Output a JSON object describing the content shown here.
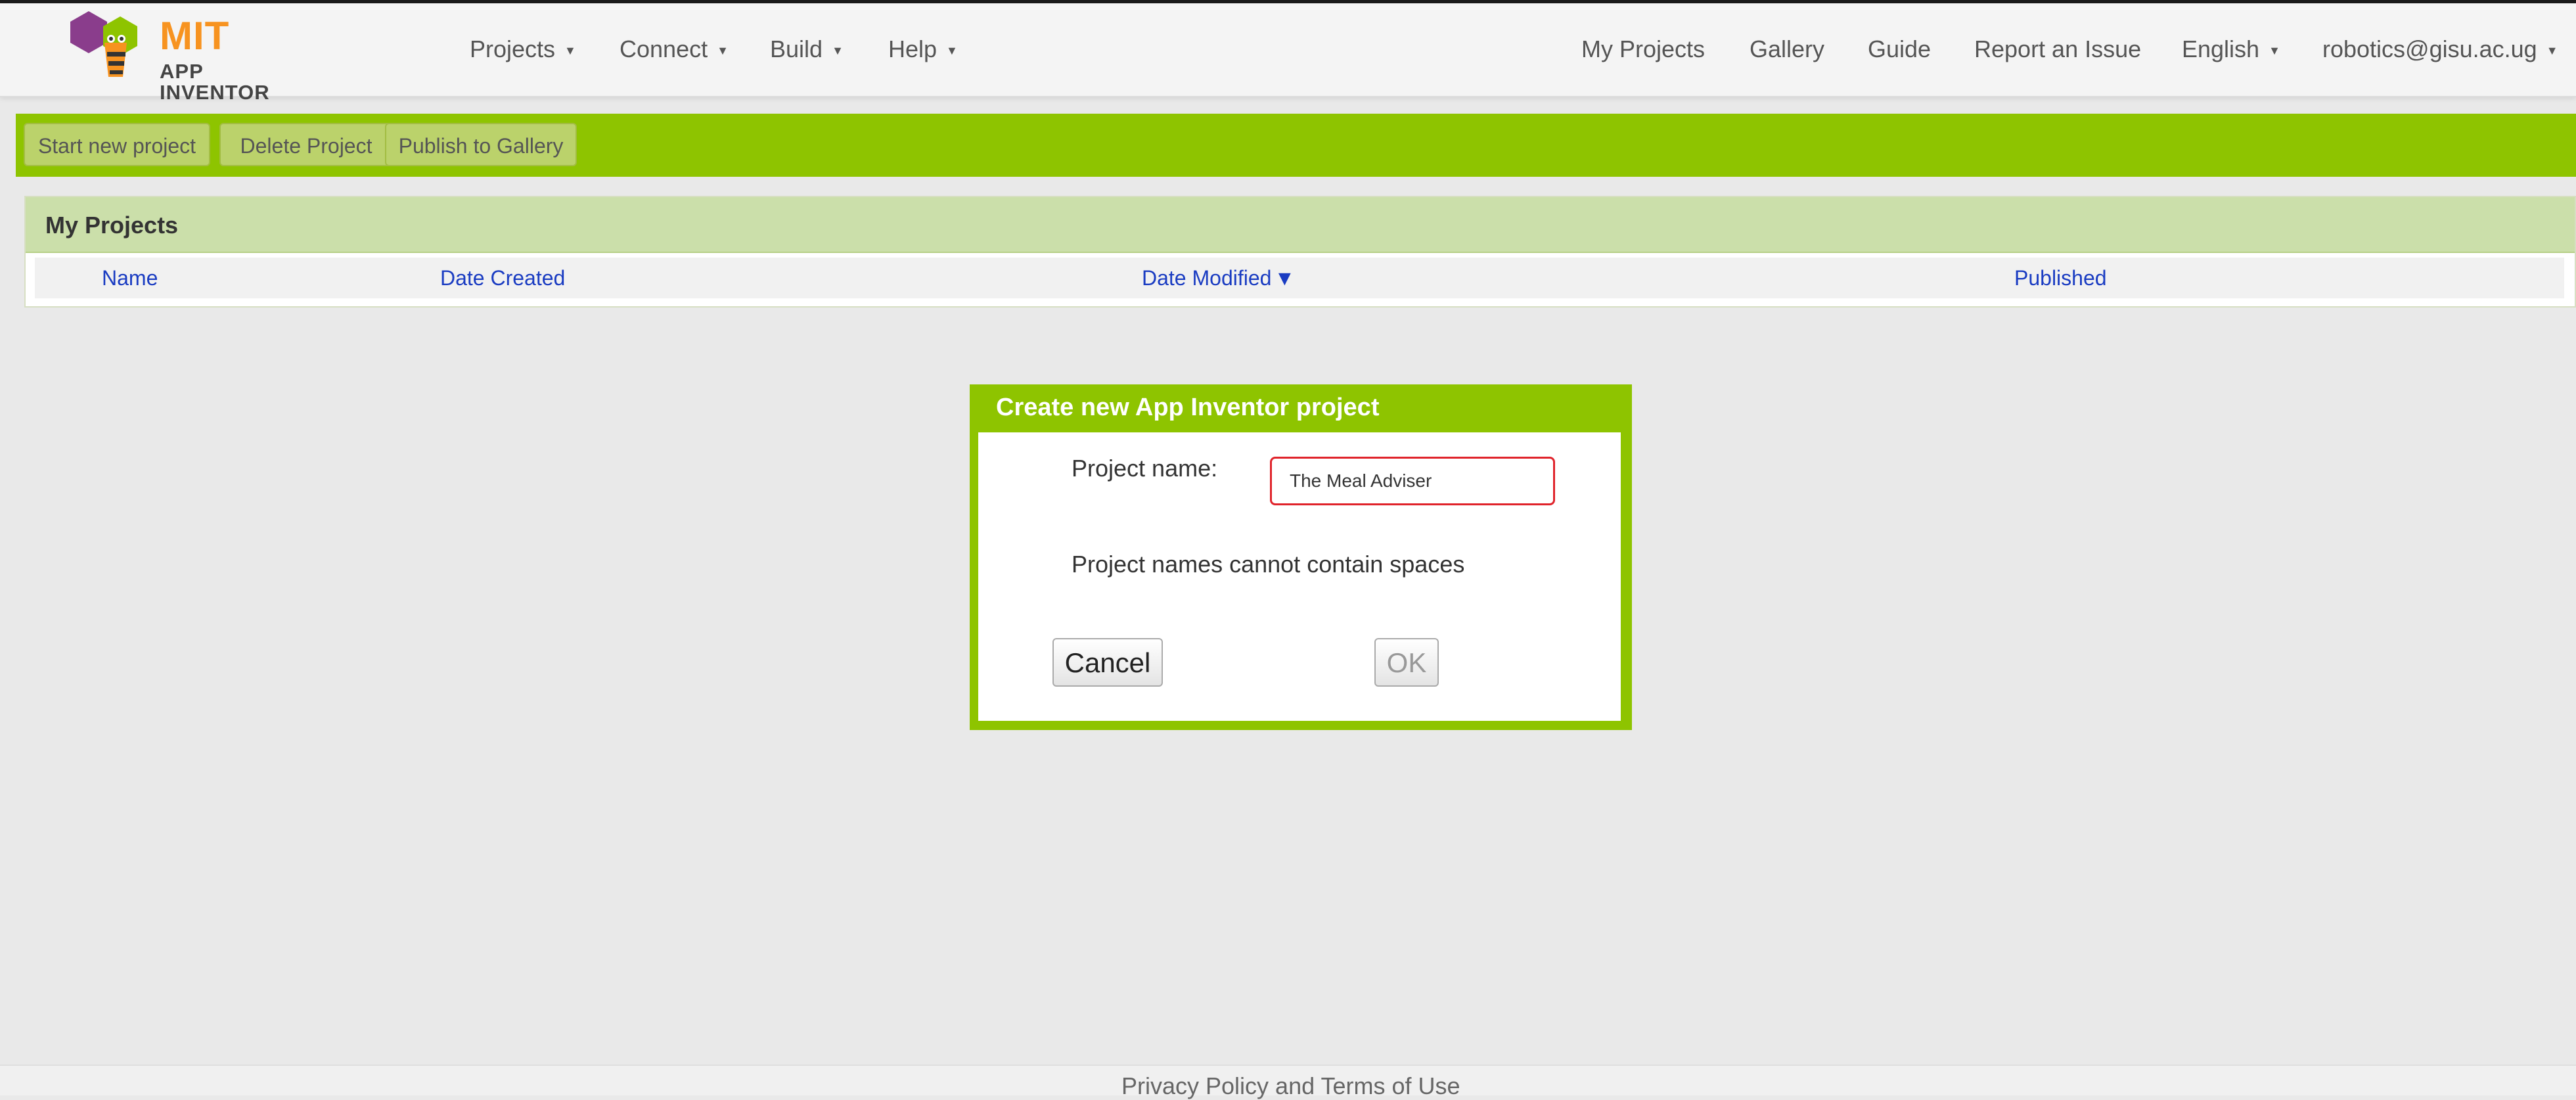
{
  "header": {
    "logo": {
      "brand": "MIT",
      "subtitle": "APP INVENTOR"
    },
    "menus": [
      {
        "label": "Projects"
      },
      {
        "label": "Connect"
      },
      {
        "label": "Build"
      },
      {
        "label": "Help"
      }
    ],
    "right_links": {
      "my_projects": "My Projects",
      "gallery": "Gallery",
      "guide": "Guide",
      "report_issue": "Report an Issue",
      "language": "English",
      "account": "robotics@gisu.ac.ug"
    }
  },
  "toolbar": {
    "start_new": "Start new project",
    "delete": "Delete Project",
    "publish": "Publish to Gallery"
  },
  "projects_panel": {
    "title": "My Projects",
    "columns": {
      "name": "Name",
      "date_created": "Date Created",
      "date_modified": "Date Modified",
      "published": "Published"
    },
    "sort_indicator": "▼"
  },
  "dialog": {
    "title": "Create new App Inventor project",
    "field_label": "Project name:",
    "field_value": "The Meal Adviser",
    "error_message": "Project names cannot contain spaces",
    "cancel_label": "Cancel",
    "ok_label": "OK"
  },
  "footer": {
    "link": "Privacy Policy and Terms of Use"
  },
  "colors": {
    "accent_green": "#8ec400",
    "panel_header": "#cbdfaa",
    "link_blue": "#1a3cc2",
    "error_red": "#e0232b",
    "brand_orange": "#f79320"
  }
}
